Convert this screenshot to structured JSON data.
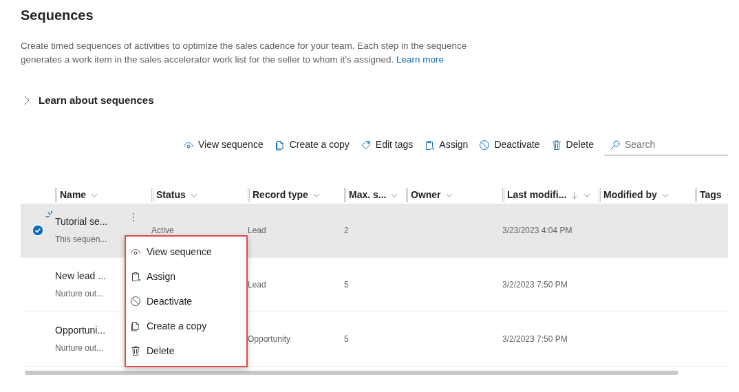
{
  "page": {
    "title": "Sequences",
    "description": "Create timed sequences of activities to optimize the sales cadence for your team. Each step in the sequence generates a work item in the sales accelerator work list for the seller to whom it’s assigned.",
    "learn_more": "Learn more"
  },
  "learn_section": {
    "label": "Learn about sequences",
    "expanded": false
  },
  "toolbar": [
    {
      "kind": "view",
      "label": "View sequence"
    },
    {
      "kind": "copy",
      "label": "Create a copy"
    },
    {
      "kind": "tags",
      "label": "Edit tags"
    },
    {
      "kind": "assign",
      "label": "Assign"
    },
    {
      "kind": "deactivate",
      "label": "Deactivate"
    },
    {
      "kind": "delete",
      "label": "Delete"
    }
  ],
  "search": {
    "placeholder": "Search"
  },
  "table": {
    "columns": [
      {
        "label": "Name",
        "sorted": false
      },
      {
        "label": "Status",
        "sorted": false
      },
      {
        "label": "Record type",
        "sorted": false
      },
      {
        "label": "Max. s...",
        "sorted": false
      },
      {
        "label": "Owner",
        "sorted": false
      },
      {
        "label": "Last modifi...",
        "sorted": true
      },
      {
        "label": "Modified by",
        "sorted": false
      },
      {
        "label": "Tags",
        "sorted": false
      }
    ],
    "rows": [
      {
        "selected": true,
        "loading": true,
        "name": "Tutorial se...",
        "description": "This sequen...",
        "status": "Active",
        "record_type": "Lead",
        "max_steps": "2",
        "last_modified": "3/23/2023 4:04 PM"
      },
      {
        "selected": false,
        "loading": false,
        "name": "New lead ...",
        "description": "Nurture out...",
        "record_type": "Lead",
        "max_steps": "5",
        "last_modified": "3/2/2023 7:50 PM"
      },
      {
        "selected": false,
        "loading": false,
        "name": "Opportuni...",
        "description": "Nurture out...",
        "record_type": "Opportunity",
        "max_steps": "5",
        "last_modified": "3/2/2023 7:50 PM"
      }
    ]
  },
  "context_menu": [
    {
      "kind": "view",
      "label": "View sequence"
    },
    {
      "kind": "assign",
      "label": "Assign"
    },
    {
      "kind": "deactivate",
      "label": "Deactivate"
    },
    {
      "kind": "copy",
      "label": "Create a copy"
    },
    {
      "kind": "delete",
      "label": "Delete"
    }
  ]
}
